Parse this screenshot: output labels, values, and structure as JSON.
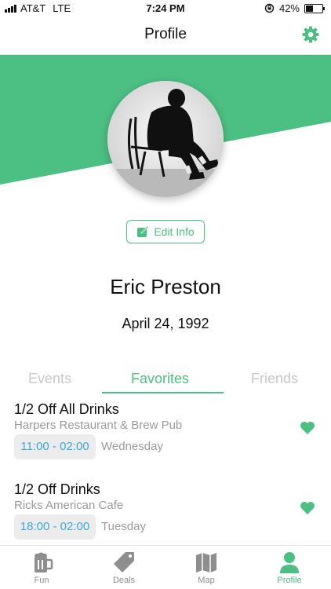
{
  "status_bar": {
    "carrier": "AT&T",
    "network": "LTE",
    "time": "7:24 PM",
    "battery_percent": "42%"
  },
  "header": {
    "title": "Profile"
  },
  "profile": {
    "edit_label": "Edit Info",
    "name": "Eric Preston",
    "birthdate": "April 24, 1992"
  },
  "tabs": [
    {
      "label": "Events",
      "active": false
    },
    {
      "label": "Favorites",
      "active": true
    },
    {
      "label": "Friends",
      "active": false
    }
  ],
  "favorites": [
    {
      "title": "1/2 Off All Drinks",
      "venue": "Harpers Restaurant & Brew Pub",
      "time": "11:00 - 02:00",
      "day": "Wednesday"
    },
    {
      "title": "1/2 Off Drinks",
      "venue": "Ricks American Cafe",
      "time": "18:00 - 02:00",
      "day": "Tuesday"
    }
  ],
  "tab_bar": [
    {
      "label": "Fun",
      "icon": "beer-mug-icon"
    },
    {
      "label": "Deals",
      "icon": "tag-icon"
    },
    {
      "label": "Map",
      "icon": "map-icon"
    },
    {
      "label": "Profile",
      "icon": "person-icon",
      "active": true
    }
  ],
  "colors": {
    "accent": "#4cbf83",
    "time_text": "#3aa8d8",
    "muted": "#9b9b9b"
  }
}
